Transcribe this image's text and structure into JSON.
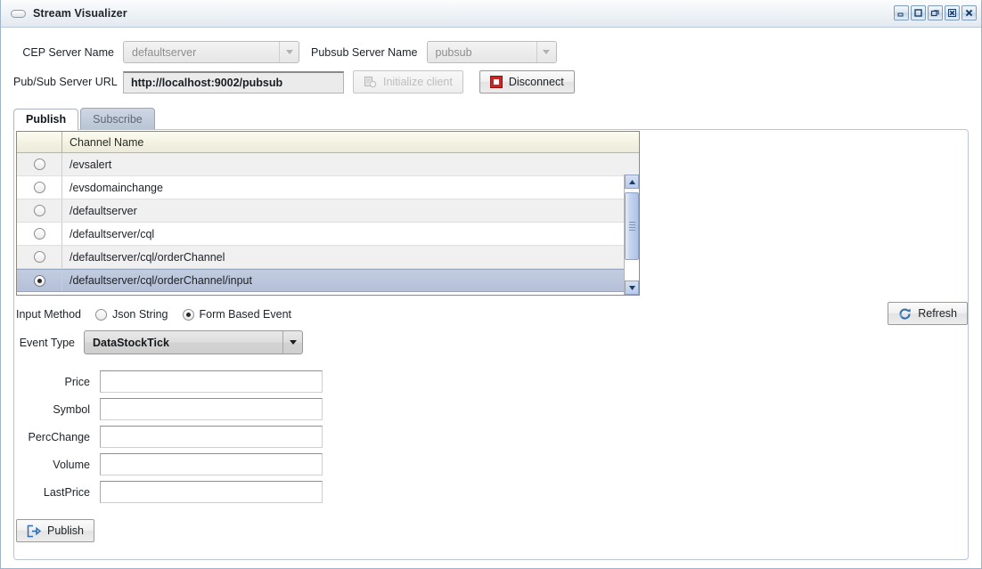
{
  "window": {
    "title": "Stream Visualizer",
    "title_icon": "pill-icon",
    "controls": [
      {
        "name": "minimize-button",
        "icon": "minimize-icon"
      },
      {
        "name": "maximize-button",
        "icon": "maximize-icon"
      },
      {
        "name": "restore-button",
        "icon": "restore-icon"
      },
      {
        "name": "close-window-button",
        "icon": "close-box-icon"
      },
      {
        "name": "close-button",
        "icon": "close-icon"
      }
    ]
  },
  "connection": {
    "cep_server_label": "CEP Server Name",
    "cep_server_value": "defaultserver",
    "pubsub_server_label": "Pubsub Server Name",
    "pubsub_server_value": "pubsub",
    "url_label": "Pub/Sub Server URL",
    "url_value": "http://localhost:9002/pubsub",
    "initialize_label": "Initialize client",
    "initialize_icon": "init-client-icon",
    "initialize_disabled": true,
    "disconnect_label": "Disconnect",
    "disconnect_icon": "stop-square-icon"
  },
  "tabs": [
    {
      "label": "Publish",
      "active": true
    },
    {
      "label": "Subscribe",
      "active": false
    }
  ],
  "channel_table": {
    "columns": [
      "",
      "Channel Name"
    ],
    "rows": [
      {
        "name": "/evsalert",
        "selected": false
      },
      {
        "name": "/evsdomainchange",
        "selected": false
      },
      {
        "name": "/defaultserver",
        "selected": false
      },
      {
        "name": "/defaultserver/cql",
        "selected": false
      },
      {
        "name": "/defaultserver/cql/orderChannel",
        "selected": false
      },
      {
        "name": "/defaultserver/cql/orderChannel/input",
        "selected": true
      }
    ]
  },
  "input_method": {
    "label": "Input Method",
    "options": [
      {
        "label": "Json String",
        "selected": false
      },
      {
        "label": "Form Based Event",
        "selected": true
      }
    ]
  },
  "refresh": {
    "label": "Refresh",
    "icon": "refresh-icon"
  },
  "event_type": {
    "label": "Event Type",
    "value": "DataStockTick"
  },
  "fields": [
    {
      "label": "Price",
      "value": "",
      "placeholder": ""
    },
    {
      "label": "Symbol",
      "value": "",
      "placeholder": ""
    },
    {
      "label": "PercChange",
      "value": "",
      "placeholder": ""
    },
    {
      "label": "Volume",
      "value": "",
      "placeholder": ""
    },
    {
      "label": "LastPrice",
      "value": "",
      "placeholder": ""
    }
  ],
  "publish": {
    "label": "Publish",
    "icon": "export-icon"
  },
  "colors": {
    "accent_blue": "#b4c0d8",
    "disconnect_red": "#cc2222",
    "header_cream": "#f3f2e2",
    "scrollbar_blue": "#aec2e8"
  }
}
